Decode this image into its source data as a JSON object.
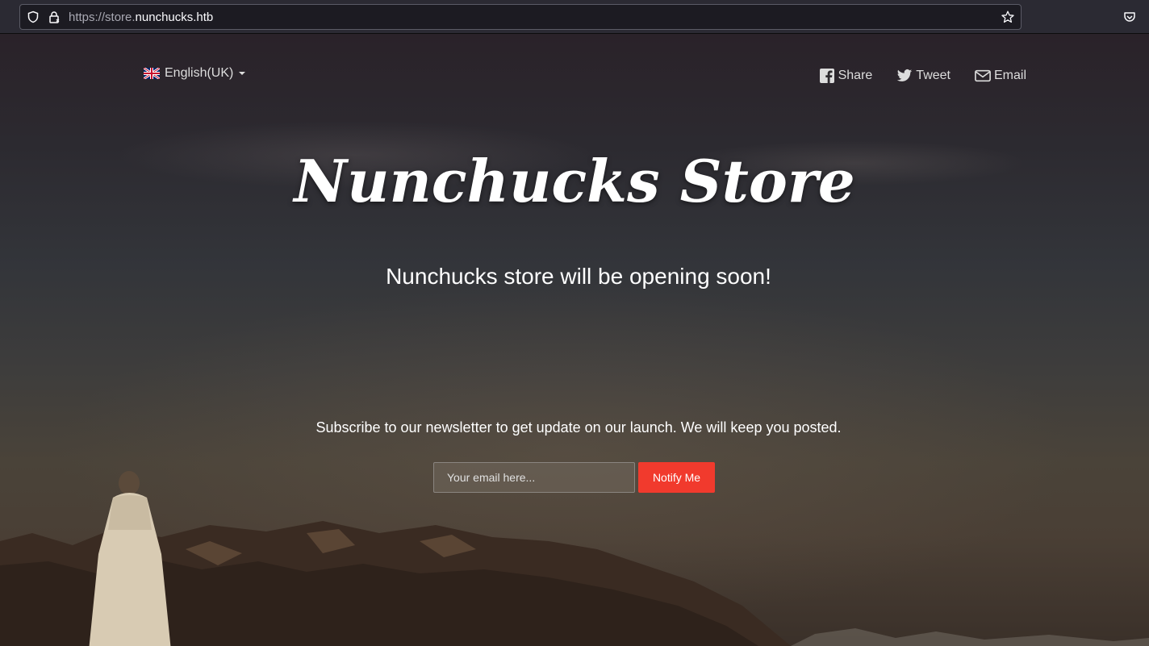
{
  "browser": {
    "url_prefix": "https://store.",
    "url_domain": "nunchucks.htb"
  },
  "nav": {
    "language": "English(UK)",
    "share_label": "Share",
    "tweet_label": "Tweet",
    "email_label": "Email"
  },
  "hero": {
    "title": "Nunchucks Store",
    "subtitle": "Nunchucks store will be opening soon!"
  },
  "newsletter": {
    "text": "Subscribe to our newsletter to get update on our launch. We will keep you posted.",
    "placeholder": "Your email here...",
    "button_label": "Notify Me"
  },
  "icons": {
    "shield": "shield-icon",
    "lock": "lock-icon",
    "star": "star-icon",
    "pocket": "pocket-icon",
    "flag": "uk-flag-icon",
    "facebook": "facebook-icon",
    "twitter": "twitter-icon",
    "email": "envelope-icon"
  },
  "colors": {
    "accent": "#f13a2d",
    "text": "#ffffff"
  }
}
